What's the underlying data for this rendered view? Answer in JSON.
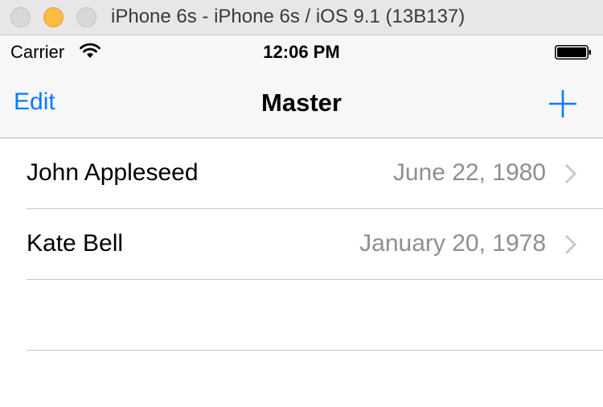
{
  "window": {
    "title": "iPhone 6s - iPhone 6s / iOS 9.1 (13B137)"
  },
  "status_bar": {
    "carrier": "Carrier",
    "time": "12:06 PM",
    "wifi_icon": "wifi-icon",
    "battery_icon": "battery-icon"
  },
  "nav": {
    "edit_label": "Edit",
    "title": "Master",
    "add_icon": "plus-icon",
    "tint_color": "#0a7aff"
  },
  "rows": [
    {
      "name": "John Appleseed",
      "date": "June 22, 1980"
    },
    {
      "name": "Kate Bell",
      "date": "January 20, 1978"
    }
  ],
  "colors": {
    "detail_text": "#8e8e93",
    "separator": "#c8c7cc",
    "minimize_button": "#fdbc40"
  }
}
